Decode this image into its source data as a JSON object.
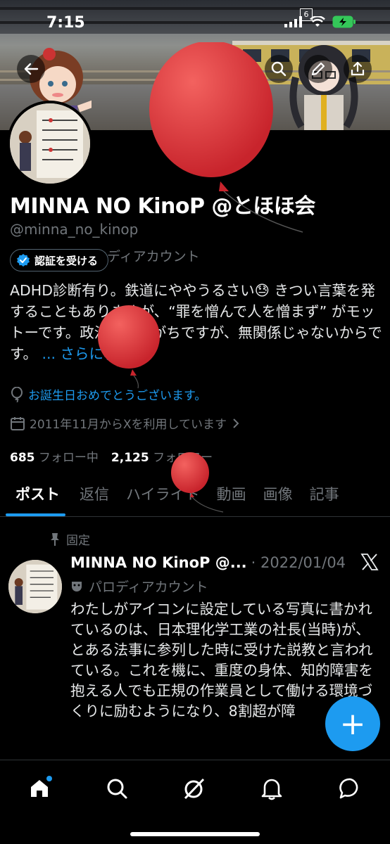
{
  "status_bar": {
    "time": "7:15",
    "sim_badge": "6"
  },
  "profile": {
    "name": "MINNA NO KinoP @とほほ会",
    "handle": "@minna_no_kinop",
    "parody_label": "パロディアカウント",
    "verify_button": "認証を受ける",
    "bio": "ADHD診断有り。鉄道にややうるさい😓 きつい言葉を発することもありますが、“罪を憎んで人を憎まず” がモットーです。政治の話しがちですが、無関係じゃないからです。",
    "bio_more": "... さらに表示",
    "birthday_text": "お誕生日おめでとうございます。",
    "joined_text": "2011年11月からXを利用しています",
    "following_count": "685",
    "following_label": "フォロー中",
    "followers_count": "2,125",
    "followers_label": "フォロワー"
  },
  "tabs": [
    {
      "label": "ポスト",
      "active": true
    },
    {
      "label": "返信"
    },
    {
      "label": "ハイライト"
    },
    {
      "label": "動画"
    },
    {
      "label": "画像"
    },
    {
      "label": "記事"
    }
  ],
  "pinned_post": {
    "pinned_label": "固定",
    "author_name": "MINNA NO KinoP @...",
    "date": "· 2022/01/04",
    "parody_label": "パロディアカウント",
    "body": "わたしがアイコンに設定している写真に書かれているのは、日本理化学工業の社長(当時)が、とある法事に参列した時に受けた説教と言われている。これを機に、重度の身体、知的障害を抱える人でも正規の作業員として働ける環境づくりに励むようになり、8割超が障"
  },
  "fab_label": "+",
  "icons": {
    "back": "back-arrow-icon",
    "search": "search-icon",
    "edit": "pencil-icon",
    "share": "share-icon",
    "home": "home-icon",
    "explore": "search-icon",
    "grok": "grok-icon",
    "notifications": "bell-icon",
    "messages": "chat-icon"
  },
  "colors": {
    "accent": "#1d9bf0",
    "balloon": "#e0393e",
    "background": "#000000"
  }
}
